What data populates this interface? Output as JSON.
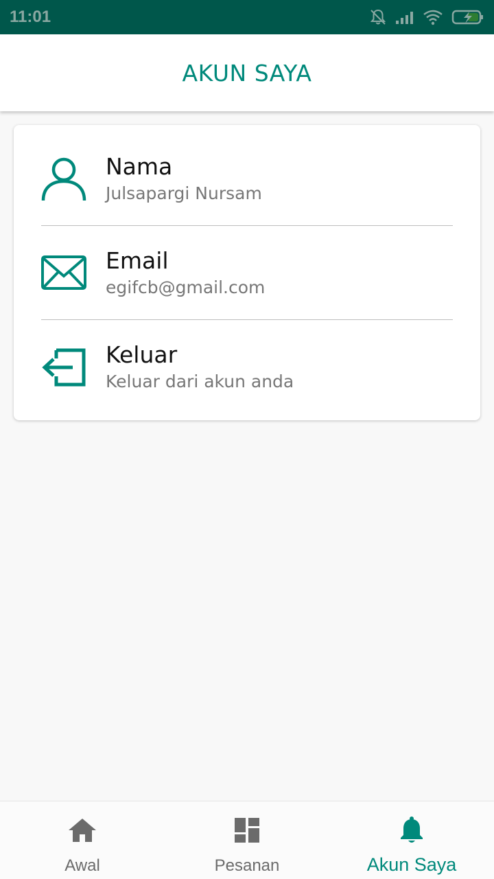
{
  "status_bar": {
    "time": "11:01",
    "icons": [
      "bell-off-icon",
      "signal-icon",
      "wifi-icon",
      "battery-charging-icon"
    ],
    "background": "#00574b"
  },
  "app_bar": {
    "title": "AKUN SAYA"
  },
  "account": {
    "items": [
      {
        "icon": "person-icon",
        "title": "Nama",
        "subtitle": "Julsapargi Nursam"
      },
      {
        "icon": "mail-icon",
        "title": "Email",
        "subtitle": "egifcb@gmail.com"
      },
      {
        "icon": "logout-icon",
        "title": "Keluar",
        "subtitle": "Keluar dari akun anda"
      }
    ]
  },
  "bottom_nav": {
    "items": [
      {
        "icon": "home-icon",
        "label": "Awal",
        "active": false
      },
      {
        "icon": "dashboard-icon",
        "label": "Pesanan",
        "active": false
      },
      {
        "icon": "bell-icon",
        "label": "Akun Saya",
        "active": true
      }
    ]
  },
  "colors": {
    "accent": "#00897b",
    "inactive": "#6b6b6b",
    "background": "#f8f8f8"
  }
}
